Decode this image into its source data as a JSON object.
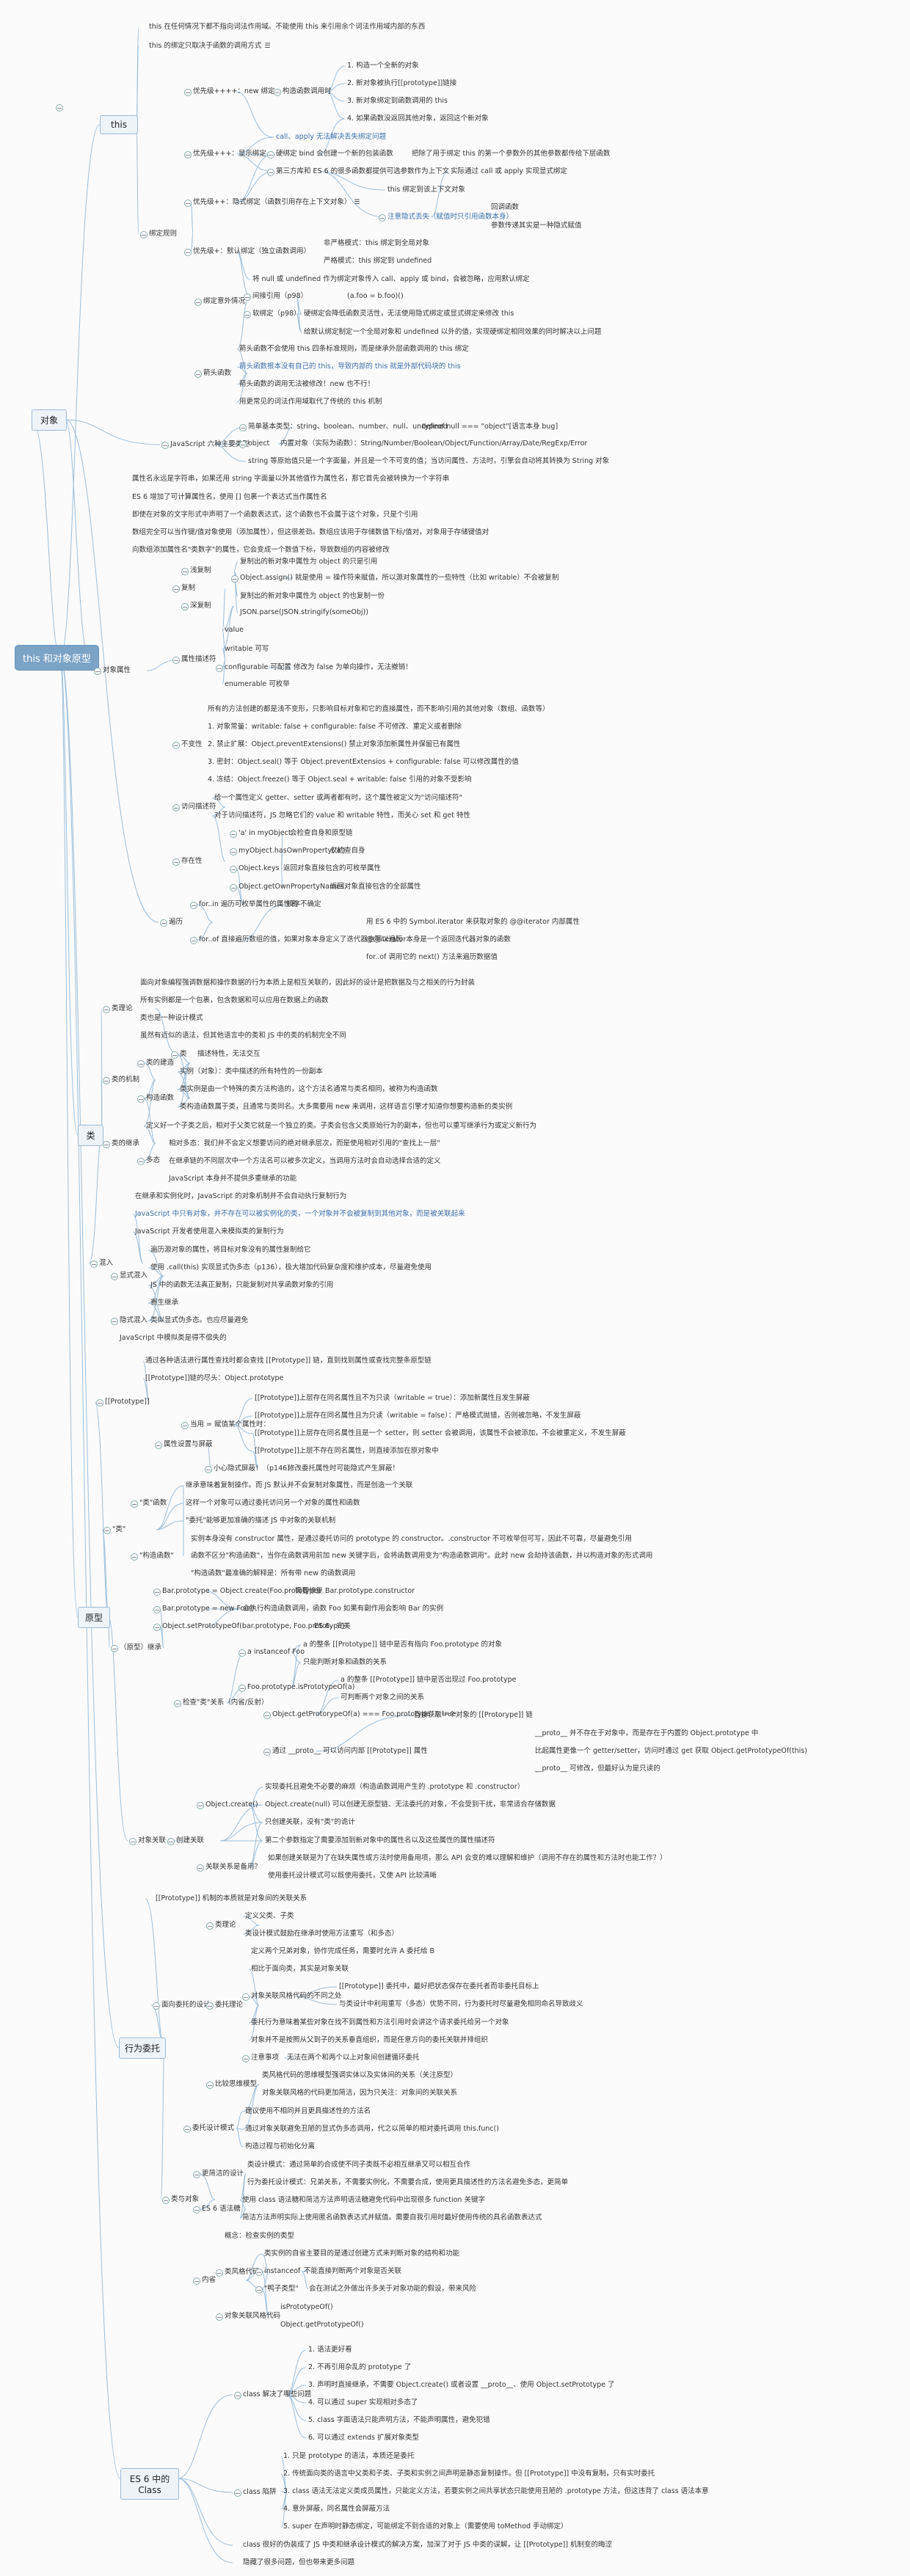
{
  "root": "this 和对象原型",
  "colors": {
    "line": "#9dbfda",
    "blue_text": "#3b6ea8",
    "root_bg": "#7ba3c6"
  },
  "icons": {
    "note": "note-icon",
    "collapse": "collapse-minus-icon"
  },
  "sections": {
    "this": {
      "title": "this",
      "nodes": [
        "this 在任何情况下都不指向词法作用域。不能使用 this 来引用余个词法作用域内部的东西",
        "this 的绑定只取决于函数的调用方式",
        "优先级++++：new 绑定",
        "构造函数调用时",
        "1. 构造一个全新的对象",
        "2. 新对象被执行[[prototype]]链接",
        "3. 新对象绑定到函数调用的 this",
        "4. 如果函数没返回其他对象，返回这个新对象",
        "优先级+++：显示绑定",
        "call、apply 无法解决丢失绑定问题",
        "硬绑定 bind 会创建一个新的包装函数",
        "把除了用于绑定 this 的第一个参数外的其他参数都传给下层函数",
        "第三方库和 ES 6 的很多函数都提供可选参数作为上下文",
        "实际通过 call 或 apply 实现显式绑定",
        "绑定规则",
        "优先级++：隐式绑定（函数引用存在上下文对象）",
        "this 绑定到该上下文对象",
        "注意隐式丢失（赋值时只引用函数本身）",
        "回调函数",
        "参数传递其实是一种隐式赋值",
        "优先级+：默认绑定（独立函数调用）",
        "非严格模式：this 绑定到全局对象",
        "严格模式：this 绑定到 undefined",
        "绑定意外情况",
        "将 null 或 undefined 作为绑定对象传入 call、apply 或 bind，会被忽略，应用默认绑定",
        "间接引用（p98）",
        "(a.foo = b.foo)()",
        "软绑定（p98）",
        "硬绑定会降低函数灵活性，无法使用隐式绑定或显式绑定来修改 this",
        "给默认绑定制定一个全局对象和 undefined 以外的值，实现硬绑定相同效果的同时解决以上问题",
        "箭头函数",
        "箭头函数不会使用 this 四条标准规则，而是继承外层函数调用的 this 绑定",
        "箭头函数根本没有自己的 this，导致内部的 this 就是外部代码块的 this",
        "箭头函数的调用无法被修改！new 也不行！",
        "用更常见的词法作用域取代了传统的 this 机制"
      ]
    },
    "object": {
      "title": "对象",
      "nodes": [
        "JavaScript 六种主要类型",
        "简单基本类型：string、boolean、number、null、undefined",
        "typeof null === \"object\"[语言本身 bug]",
        "object",
        "内置对象（实际为函数）：String/Number/Boolean/Object/Function/Array/Date/RegExp/Error",
        "string 等原始值只是一个字面量，并且是一个不可变的值；当访问属性、方法时，引擎会自动将其转换为 String 对象",
        "属性名永远是字符串，如果还用 string 字面量以外其他值作为属性名，那它首先会被转换为一个字符串",
        "ES 6 增加了可计算属性名，使用 [] 包裹一个表达式当作属性名",
        "即使在对象的文字形式中声明了一个函数表达式，这个函数也不会属于这个对象，只是个引用",
        "数组完全可以当作键/值对象使用（添加属性），但这很差劲。数组应该用于存储数值下标/值对，对象用于存储键值对",
        "向数组添加属性名\"类数字\"的属性，它会变成一个数值下标，导致数组的内容被修改",
        "浅复制",
        "复制出的新对象中属性为 object 的只是引用",
        "Object.assign()",
        "就是使用 = 操作符来赋值，所以源对象属性的一些特性（比如 writable）不会被复制",
        "复制",
        "深复制",
        "复制出的新对象中属性为 object 的也复制一份",
        "JSON.parse(JSON.stringify(someObj))",
        "value",
        "writable 可写",
        "属性描述符",
        "configurable 可配置",
        "修改为 false 为单向操作，无法撤销！",
        "enumerable 可枚举",
        "对象属性",
        "所有的方法创建的都是浅不变形，只影响目标对象和它的直接属性，而不影响引用的其他对象（数组、函数等）",
        "1. 对象常量：writable: false + configurable: false 不可修改、重定义或者删除",
        "不变性",
        "2. 禁止扩展：Object.preventExtensions() 禁止对象添加新属性并保留已有属性",
        "3. 密封：Object.seal() 等于 Object.preventExtensios + configurable: false 可以修改属性的值",
        "4. 冻结：Object.freeze() 等于 Object.seal + writable: false 引用的对象不受影响",
        "给一个属性定义 getter、setter 或两者都有时，这个属性被定义为\"访问描述符\"",
        "访问描述符",
        "对于访问描述符，JS 忽略它们的 value 和 writable 特性，而关心 set 和 get 特性",
        "'a' in myObject",
        "会检查自身和原型链",
        "myObject.hasOwnProperty('a')",
        "仅检查自身",
        "存在性",
        "Object.keys",
        "返回对象直接包含的可枚举属性",
        "Object.getOwnPropertyNames",
        "返回对象直接包含的全部属性",
        "for..in 遍历可枚举属性的属性名",
        "顺序不确定",
        "遍历",
        "用 ES 6 中的 Symbol.iterator 来获取对象的 @@iterator 内部属性",
        "for..of 直接遍历数组的值，如果对象本身定义了迭代器也可以遍历",
        "@@iterator本身是一个返回迭代器对象的函数",
        "for..of 调用它的 next() 方法来遍历数据值"
      ]
    },
    "class": {
      "title": "类",
      "nodes": [
        "面向对象编程强调数据和操作数据的行为本质上是相互关联的，因此好的设计是把数据及与之相关的行为封装",
        "所有实例都是一个包裹，包含数据和可以应用在数据上的函数",
        "类理论",
        "类也是一种设计模式",
        "虽然有近似的语法，但其他语言中的类和 JS 中的类的机制完全不同",
        "类",
        "描述特性，无法交互",
        "类的建造",
        "实例（对象）：类中描述的所有特性的一份副本",
        "类的机制",
        "类实例是由一个特殊的类方法构造的，这个方法名通常与类名相同，被称为构造函数",
        "构造函数",
        "类构造函数属于类，且通常与类同名。大多需要用 new 来调用，这样语言引擎才知道你想要构造新的类实例",
        "定义好一个子类之后，相对于父类它就是一个独立的类。子类会包含父类原始行为的副本，但也可以重写继承行为或定义新行为",
        "类的继承",
        "相对多态：我们并不会定义想要访问的绝对继承层次，而是使用相对引用的\"查找上一层\"",
        "多态",
        "在继承链的不同层次中一个方法名可以被多次定义，当调用方法时会自动选择合适的定义",
        "JavaScript 本身并不提供多重继承的功能",
        "在继承和实例化时，JavaScript 的对象机制并不会自动执行复制行为",
        "JavaScript 中只有对象，并不存在可以被实例化的类，一个对象并不会被复制到其他对象，而是被关联起来",
        "JavaScript 开发者使用混入来模拟类的复制行为",
        "遍历源对象的属性，将目标对象没有的属性复制给它",
        "混入",
        "使用 .call(this) 实现显式伪多态（p136），极大增加代码复杂度和维护成本，尽量避免使用",
        "显式混入",
        "JS 中的函数无法真正复制，只能复制对共享函数对象的引用",
        "寄生继承",
        "隐式混入",
        "类似显式伪多态。也应尽量避免",
        "JavaScript 中模拟类是得不偿失的"
      ]
    },
    "prototype": {
      "title": "原型",
      "nodes": [
        "通过各种语法进行属性查找时都会查找 [[Prototype]] 链，直到找到属性或查找完整条原型链",
        "[[Prototype]]链的尽头：Object.prototype",
        "[[Prototype]]",
        "[[Prototype]]上层存在同名属性且不为只读（writable = true）：添加新属性且发生屏蔽",
        "[[Prototype]]上层存在同名属性且为只读（writable = false）：严格模式抛错，否则被忽略，不发生屏蔽",
        "当用 = 赋值某个属性时：",
        "[[Prototype]]上层存在同名属性且是一个 setter，则 setter 会被调用，该属性不会被添加，不会被重定义，不发生屏蔽",
        "属性设置与屏蔽",
        "[[Prototype]]上层不存在同名属性，则直接添加在原对象中",
        "小心隐式屏蔽！（p146）",
        "修改委托属性时可能隐式产生屏蔽！",
        "继承意味着复制操作。而 JS 默认并不会复制对象属性，而是创造一个关联",
        "\"类\"函数",
        "这样一个对象可以通过委托访问另一个对象的属性和函数",
        "\"委托\"能够更加准确的描述 JS 中对象的关联机制",
        "\"类\"",
        "实例本身没有 constructor 属性，是通过委托访问的 prototype 的 constructor。.constructor 不可枚举但可写，因此不可靠，尽量避免引用",
        "\"构造函数\"",
        "函数不区分\"构造函数\"，当你在函数调用前加 new 关键字后，会将函数调用变为\"构造函数调用\"。此时 new 会劫持该函数，并以构造对象的形式调用",
        "\"构造函数\"最准确的解释是：所有带 new 的函数调用",
        "Bar.prototype = Object.create(Foo.prototype)",
        "需要修复 Bar.prototype.constructor",
        "Bar.prototype = new Foo()",
        "会执行构造函数调用，函数 Foo 如果有副作用会影响 Bar 的实例",
        "Object.setPrototypeOf(bar.prototype, Foo.prototype)",
        "ES 6，完美",
        "（原型）继承",
        "a instanceof Foo",
        "a 的整条 [[Prototype]] 链中是否有指向 Foo.prototype 的对象",
        "只能判断对象和函数的关系",
        "Foo.prototype.isPrototypeOf(a)",
        "a 的整条 [[Prototype]] 链中是否出现过 Foo.prototype",
        "检查\"类\"关系（内省/反射）",
        "可判断两个对象之间的关系",
        "Object.getProtorypeOf(a) === Foo.prototype;  // true",
        "直接获取一个对象的 [[Protorype]] 链",
        "__proto__ 并不存在于对象中，而是存在于内置的 Object.prototype 中",
        "通过 __proto__ 可以访问内部 [[Prototype]] 属性",
        "比起属性更像一个 getter/setter，访问时通过 get 获取  Object.getPrototypeOf(this)",
        "__proto__ 可修改，但最好认为是只读的",
        "实现委托且避免不必要的麻烦（构造函数调用产生的 .prototype 和 .constructor）",
        "Object.create()",
        "Object.create(null) 可以创建无原型链、无法委托的对象，不会受到干扰，非常适合存储数据",
        "只创建关联，没有\"类\"的诡计",
        "对象关联",
        "创建关联",
        "第二个参数指定了需要添加到新对象中的属性名以及这些属性的属性描述符",
        "如果创建关联是为了在缺失属性或方法时使用备用项，那么 API 会变的难以理解和维护（调用不存在的属性和方法时也能工作？）",
        "关联关系是备用？",
        "使用委托设计模式可以既使用委托，又使 API 比较清晰"
      ]
    },
    "delegation": {
      "title": "行为委托",
      "nodes": [
        "[[Prototype]] 机制的本质就是对象间的关联关系",
        "定义父类、子类",
        "类理论",
        "类设计模式鼓励在继承时使用方法重写（和多态）",
        "定义两个兄弟对象，协作完成任务，需要时允许 A 委托给 B",
        "相比于面向类，其实是对象关联",
        "[[Prototype]] 委托中，最好把状态保存在委托者而非委托目标上",
        "对象关联风格代码的不同之处",
        "面向委托的设计",
        "委托理论",
        "与类设计中利用重写（多态）优势不同，行为委托时尽量避免相同命名导致歧义",
        "委托行为意味着某些对象在找不到属性和方法引用时会讲这个请求委托给另一个对象",
        "对象并不是按照从父到子的关系垂直组织，而是任意方向的委托关联并排组织",
        "注意事项",
        "无法在两个和两个以上对象间创建循环委托",
        "类风格代码的思维模型强调实体以及实体间的关系（关注原型）",
        "比较思维模型",
        "对象关联风格的代码更加简洁，因为只关注：对象间的关联关系",
        "建议使用不相同并且更具描述性的方法名",
        "委托设计模式",
        "通过对象关联避免丑陋的显式伪多态调用，代之以简单的相对委托调用 this.func()",
        "构造过程与初始化分离",
        "类设计模式：通过简单的合成使不同子类既不必相互继承又可以相互合作",
        "更简洁的设计",
        "行为委托设计模式：兄弟关系，不需要实例化，不需要合成，使用更具描述性的方法名避免多态，更简单",
        "类与对象",
        "使用 class 语法糖和简洁方法声明语法糖避免代码中出现很多 function 关键字",
        "ES 6 语法糖",
        "简洁方法声明实际上使用匿名函数表达式并赋值。需要自我引用时最好使用传统的具名函数表达式",
        "概念：检查实例的类型",
        "类实例的自省主要目的是通过创建方式来判断对象的结构和功能",
        "类风格代码",
        "instanceof",
        "不能直接判断两个对象是否关联",
        "内省",
        "\"鸭子类型\"",
        "会在测试之外做出许多关于对象功能的假设，带来风险",
        "isPrototypeOf()",
        "对象关联风格代码",
        "Object.getPrototypeOf()"
      ]
    },
    "es6class": {
      "title": "ES 6 中的 Class",
      "nodes": [
        "1. 语法更好看",
        "2. 不再引用杂乱的 prototype 了",
        "3. 声明时直接继承，不需要 Object.create() 或者设置 __proto__、使用 Object.setPrototype 了",
        "class 解决了哪些问题",
        "4. 可以通过 super 实现相对多态了",
        "5. class 字面语法只能声明方法，不能声明属性，避免犯错",
        "6. 可以通过 extends 扩展对象类型",
        "1. 只是 prototype 的语法，本质还是委托",
        "2. 传统面向类的语言中父类和子类、子类和实例之间声明是静态复制操作。但 [[Prototype]] 中没有复制，只有实时委托",
        "class 陷阱",
        "3. class 语法无法定义类成员属性，只能定义方法，若要实例之间共享状态只能使用丑陋的 .prototype 方法，但这违背了 class 语法本意",
        "4. 意外屏蔽，同名属性会屏蔽方法",
        "5. super 在声明时静态绑定，可能绑定不到合适的对象上（需要使用 toMethod 手动绑定）",
        "class 很好的伪装成了 JS 中类和继承设计模式的解决方案，加深了对于 JS 中类的误解，让 [[Prototype]] 机制变的晦涩",
        "隐藏了很多问题，但也带来更多问题"
      ]
    }
  }
}
